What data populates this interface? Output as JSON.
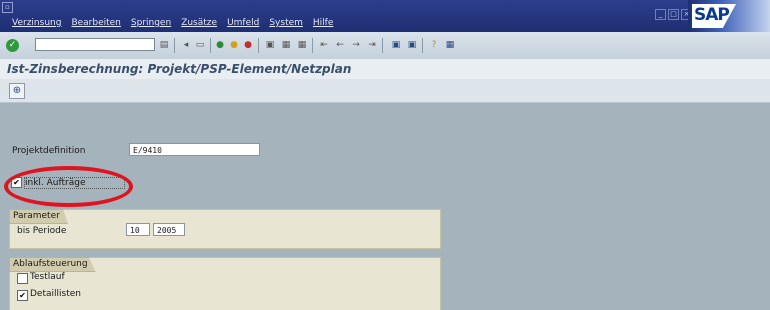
{
  "menubar": {
    "items": [
      "Verzinsung",
      "Bearbeiten",
      "Springen",
      "Zusätze",
      "Umfeld",
      "System",
      "Hilfe"
    ],
    "logo": "SAP"
  },
  "toolbar": {
    "command_value": ""
  },
  "screen": {
    "title": "Ist-Zinsberechnung: Projekt/PSP-Element/Netzplan"
  },
  "form": {
    "projektdefinition_label": "Projektdefinition",
    "projektdefinition_value": "E/9410",
    "inkl_auftraege_label": "inkl. Aufträge",
    "inkl_auftraege_checked": true
  },
  "parameter": {
    "title": "Parameter",
    "bis_periode_label": "bis Periode",
    "periode_value": "10",
    "jahr_value": "2005"
  },
  "ablaufsteuerung": {
    "title": "Ablaufsteuerung",
    "testlauf_label": "Testlauf",
    "testlauf_checked": false,
    "detaillisten_label": "Detaillisten",
    "detaillisten_checked": true
  },
  "colors": {
    "menubar": "#1e2f73",
    "background": "#a5b3bc",
    "group_bg": "#e8e5d2",
    "highlight": "#e0141e"
  }
}
